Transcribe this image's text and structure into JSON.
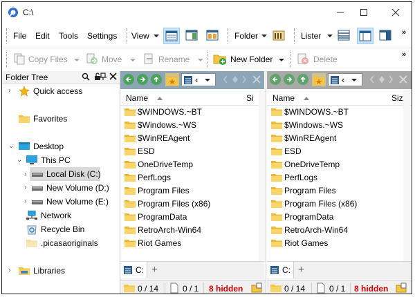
{
  "window": {
    "title": "C:\\"
  },
  "menu": [
    "File",
    "Edit",
    "Tools",
    "Settings"
  ],
  "toolbar": {
    "view_label": "View",
    "folder_label": "Folder",
    "lister_label": "Lister",
    "copy_files": "Copy Files",
    "move": "Move",
    "rename": "Rename",
    "new_folder": "New Folder",
    "delete": "Delete",
    "overflow": "»"
  },
  "tree": {
    "title": "Folder Tree",
    "items": [
      {
        "label": "Quick access"
      },
      {
        "label": "Favorites"
      },
      {
        "label": "Desktop"
      },
      {
        "label": "This PC"
      },
      {
        "label": "Local Disk (C:)"
      },
      {
        "label": "New Volume (D:)"
      },
      {
        "label": "New Volume (E:)"
      },
      {
        "label": "Network"
      },
      {
        "label": "Recycle Bin"
      },
      {
        "label": ".picasaoriginals"
      },
      {
        "label": "Libraries"
      }
    ]
  },
  "lister": {
    "col_name": "Name",
    "col_size": "Si",
    "col_size_right": "Siz",
    "tab_label": "C:",
    "add_tab": "+",
    "files": [
      "$WINDOWS.~BT",
      "$Windows.~WS",
      "$WinREAgent",
      "ESD",
      "OneDriveTemp",
      "PerfLogs",
      "Program Files",
      "Program Files (x86)",
      "ProgramData",
      "RetroArch-Win64",
      "Riot Games"
    ]
  },
  "status": {
    "folders": "0 / 14",
    "files": "0 / 1",
    "hidden": "8 hidden"
  },
  "colors": {
    "folder": "#f5c542",
    "pane_toolbar": "#8da5b6",
    "selection": "#cce4f7",
    "hidden_text": "#d40000"
  }
}
